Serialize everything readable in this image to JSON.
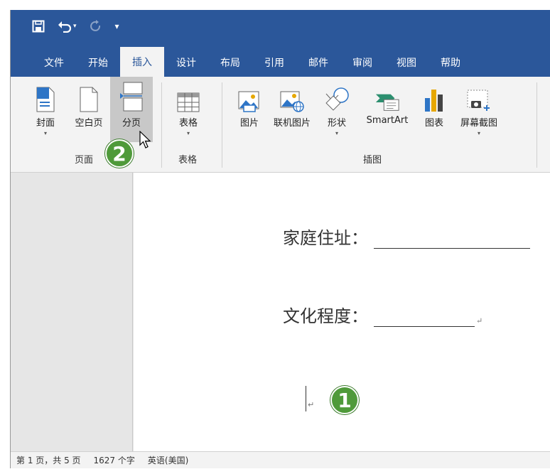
{
  "qat": {
    "save_icon": "save-icon",
    "undo_icon": "undo-icon",
    "redo_icon": "redo-icon",
    "customize_icon": "customize-qat-icon"
  },
  "tabs": [
    {
      "label": "文件"
    },
    {
      "label": "开始"
    },
    {
      "label": "插入",
      "active": true
    },
    {
      "label": "设计"
    },
    {
      "label": "布局"
    },
    {
      "label": "引用"
    },
    {
      "label": "邮件"
    },
    {
      "label": "审阅"
    },
    {
      "label": "视图"
    },
    {
      "label": "帮助"
    }
  ],
  "ribbon": {
    "pages_group": {
      "label": "页面",
      "cover": "封面",
      "blank_page": "空白页",
      "page_break": "分页"
    },
    "tables_group": {
      "label": "表格",
      "table": "表格"
    },
    "illustrations_group": {
      "label": "插图",
      "pictures": "图片",
      "online_pictures": "联机图片",
      "shapes": "形状",
      "smartart": "SmartArt",
      "chart": "图表",
      "screenshot": "屏幕截图"
    }
  },
  "document": {
    "line1_label": "家庭住址：",
    "line2_label": "文化程度：",
    "para_mark": "↵"
  },
  "badges": {
    "one": "1",
    "two": "2"
  },
  "status": {
    "page": "第 1 页，共 5 页",
    "words": "1627 个字",
    "language": "英语(美国)"
  },
  "colors": {
    "brand": "#2b579a",
    "badge": "#4f9a3a"
  }
}
